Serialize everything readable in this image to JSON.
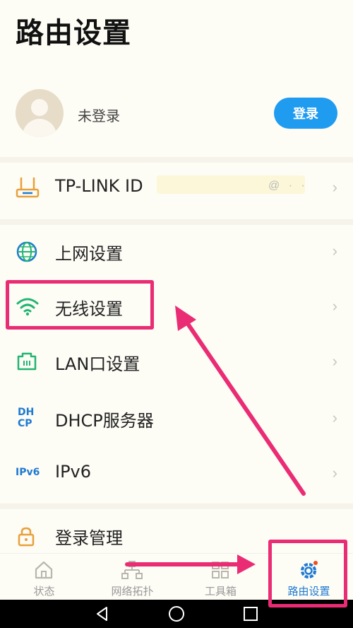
{
  "page": {
    "title": "路由设置"
  },
  "user": {
    "name": "未登录",
    "login_label": "登录"
  },
  "menu": {
    "items": [
      {
        "label": "TP-LINK ID",
        "icon": "router-icon"
      },
      {
        "label": "上网设置",
        "icon": "globe-icon"
      },
      {
        "label": "无线设置",
        "icon": "wifi-icon"
      },
      {
        "label": "LAN口设置",
        "icon": "lan-port-icon"
      },
      {
        "label": "DHCP服务器",
        "icon": "dhcp-icon",
        "icon_text": [
          "DH",
          "CP"
        ]
      },
      {
        "label": "IPv6",
        "icon": "ipv6-icon",
        "icon_text": "IPv6"
      },
      {
        "label": "登录管理",
        "icon": "lock-icon"
      }
    ],
    "chevron": "›",
    "tp_link_id_blurred_suffix": "@ ·  ·"
  },
  "tabbar": {
    "tabs": [
      {
        "label": "状态",
        "icon": "home-icon",
        "active": false
      },
      {
        "label": "网络拓扑",
        "icon": "topology-icon",
        "active": false
      },
      {
        "label": "工具箱",
        "icon": "toolbox-icon",
        "active": false
      },
      {
        "label": "路由设置",
        "icon": "gear-icon",
        "active": true
      }
    ]
  },
  "colors": {
    "accent": "#1f9bf0",
    "active_tab": "#1f7ad1",
    "annotation": "#ea2c74",
    "background": "#fdfcf5",
    "wifi": "#22b573",
    "icon_orange": "#e8a03a"
  }
}
